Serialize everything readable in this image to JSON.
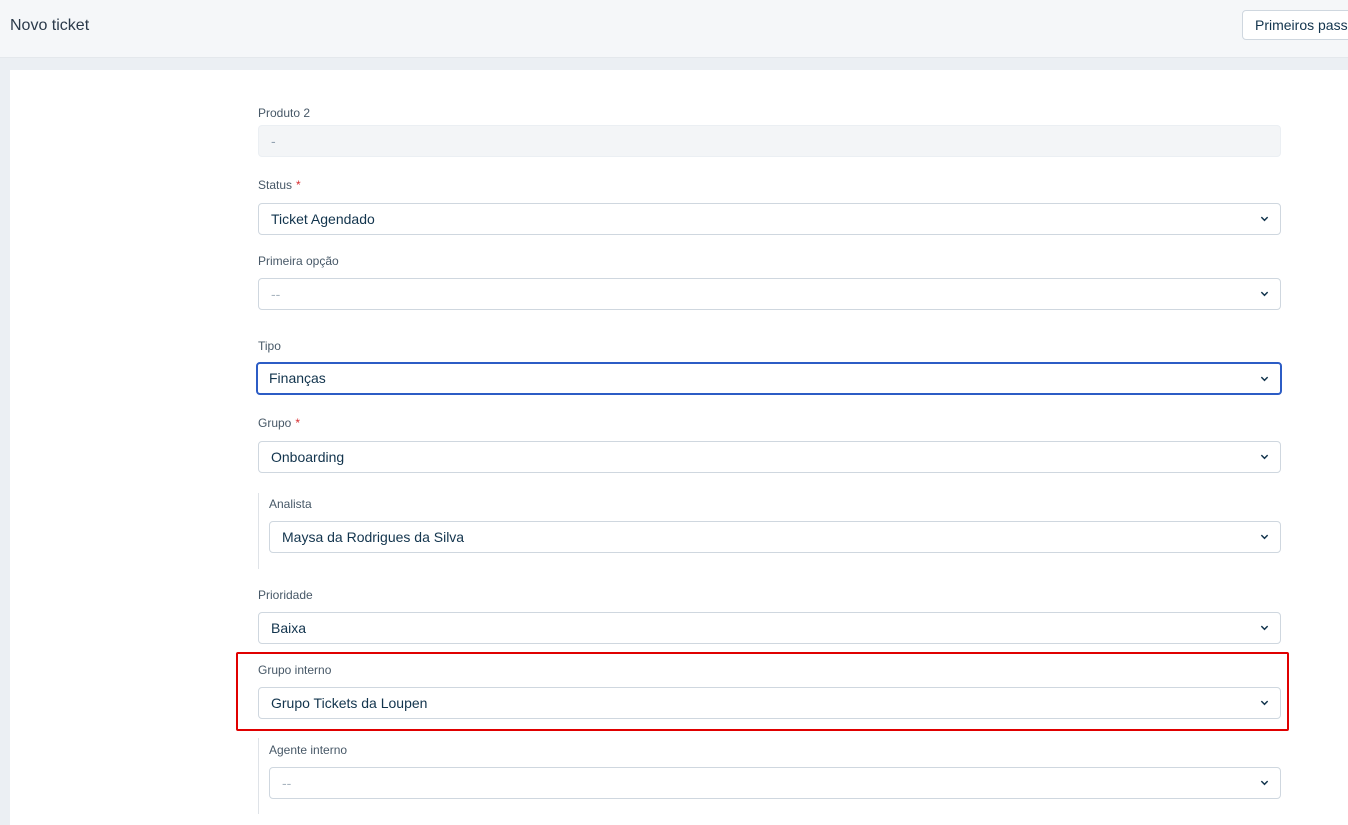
{
  "header": {
    "title": "Novo ticket",
    "help_button": "Primeiros passos"
  },
  "form": {
    "produto2": {
      "label": "Produto 2",
      "value": "-"
    },
    "status": {
      "label": "Status",
      "required_mark": "*",
      "value": "Ticket Agendado"
    },
    "primeira_opcao": {
      "label": "Primeira opção",
      "value": "--"
    },
    "tipo": {
      "label": "Tipo",
      "value": "Finanças"
    },
    "grupo": {
      "label": "Grupo",
      "required_mark": "*",
      "value": "Onboarding"
    },
    "analista": {
      "label": "Analista",
      "value": "Maysa da Rodrigues da Silva"
    },
    "prioridade": {
      "label": "Prioridade",
      "value": "Baixa"
    },
    "grupo_interno": {
      "label": "Grupo interno",
      "value": "Grupo Tickets da Loupen"
    },
    "agente_interno": {
      "label": "Agente interno",
      "value": "--"
    }
  },
  "colors": {
    "highlight_border": "#e00000",
    "focus_border": "#2c5cc5",
    "required": "#d72d30"
  }
}
